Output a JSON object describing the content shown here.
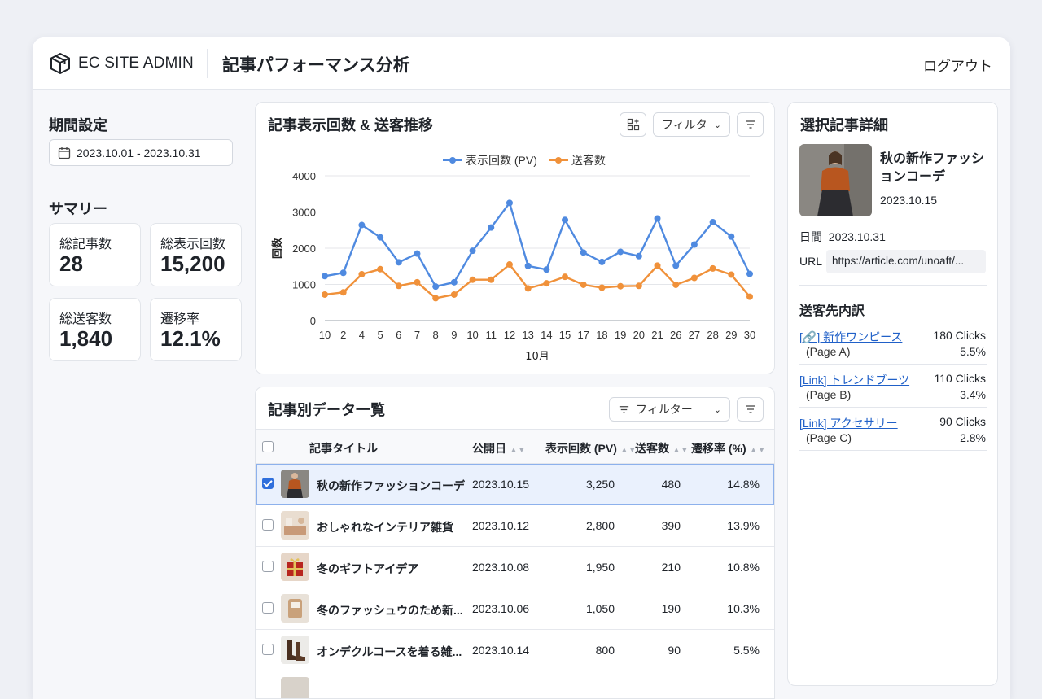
{
  "header": {
    "brand": "EC SITE ADMIN",
    "title": "記事パフォーマンス分析",
    "logout": "ログアウト"
  },
  "period": {
    "label": "期間設定",
    "range": "2023.10.01 - 2023.10.31"
  },
  "summary": {
    "label": "サマリー",
    "cards": [
      {
        "label": "総記事数",
        "value": "28"
      },
      {
        "label": "総表示回数",
        "value": "15,200"
      },
      {
        "label": "総送客数",
        "value": "1,840"
      },
      {
        "label": "遷移率",
        "value": "12.1%"
      }
    ]
  },
  "trend_panel": {
    "title": "記事表示回数 & 送客推移",
    "filter_label": "フィルタ"
  },
  "chart_data": {
    "type": "line",
    "title": "",
    "xlabel": "10月",
    "ylabel": "回数",
    "ylim": [
      0,
      4000
    ],
    "yticks": [
      "0",
      "1000",
      "2000",
      "3000",
      "4000"
    ],
    "categories": [
      "10",
      "2",
      "4",
      "5",
      "6",
      "7",
      "8",
      "9",
      "10",
      "11",
      "12",
      "13",
      "14",
      "15",
      "17",
      "18",
      "19",
      "20",
      "21",
      "26",
      "27",
      "28",
      "29",
      "30"
    ],
    "grid": true,
    "legend_position": "top",
    "series": [
      {
        "name": "表示回数 (PV)",
        "color": "#4f8ae0",
        "values": [
          1230,
          1320,
          2640,
          2300,
          1610,
          1850,
          940,
          1060,
          1930,
          2570,
          3250,
          1510,
          1410,
          2780,
          1880,
          1620,
          1900,
          1780,
          2820,
          1520,
          2100,
          2720,
          2320,
          1290
        ]
      },
      {
        "name": "送客数",
        "color": "#f0913a",
        "values": [
          720,
          780,
          1280,
          1420,
          960,
          1060,
          620,
          720,
          1130,
          1130,
          1550,
          890,
          1030,
          1210,
          990,
          910,
          950,
          960,
          1520,
          990,
          1180,
          1440,
          1270,
          660
        ]
      }
    ]
  },
  "table_panel": {
    "title": "記事別データ一覧",
    "filter_label": "フィルター",
    "columns": [
      "記事タイトル",
      "公開日",
      "表示回数 (PV)",
      "送客数",
      "遷移率 (%)"
    ],
    "rows": [
      {
        "title": "秋の新作ファッションコーデ",
        "date": "2023.10.15",
        "pv": "3,250",
        "sends": "480",
        "rate": "14.8%",
        "thumb": "fashion",
        "selected": true
      },
      {
        "title": "おしゃれなインテリア雑貨",
        "date": "2023.10.12",
        "pv": "2,800",
        "sends": "390",
        "rate": "13.9%",
        "thumb": "interior",
        "selected": false
      },
      {
        "title": "冬のギフトアイデア",
        "date": "2023.10.08",
        "pv": "1,950",
        "sends": "210",
        "rate": "10.8%",
        "thumb": "gift",
        "selected": false
      },
      {
        "title": "冬のファッシュウのため新...",
        "date": "2023.10.06",
        "pv": "1,050",
        "sends": "190",
        "rate": "10.3%",
        "thumb": "winter",
        "selected": false
      },
      {
        "title": "オンデクルコースを着る雑...",
        "date": "2023.10.14",
        "pv": "800",
        "sends": "90",
        "rate": "5.5%",
        "thumb": "boots",
        "selected": false
      }
    ]
  },
  "detail": {
    "title": "選択記事詳細",
    "article_title": "秋の新作ファッションコーデ",
    "article_date": "2023.10.15",
    "period_label": "日間",
    "period_value": "2023.10.31",
    "url_label": "URL",
    "url_value": "https://article.com/unoaft/...",
    "referrals_title": "送客先内訳",
    "referrals": [
      {
        "link": "[🔗] 新作ワンピース",
        "clicks": "180 Clicks",
        "page": "(Page A)",
        "pct": "5.5%"
      },
      {
        "link": "[Link] トレンドブーツ",
        "clicks": "110 Clicks",
        "page": "(Page B)",
        "pct": "3.4%"
      },
      {
        "link": "[Link] アクセサリー",
        "clicks": "90 Clicks",
        "page": "(Page C)",
        "pct": "2.8%"
      }
    ]
  }
}
